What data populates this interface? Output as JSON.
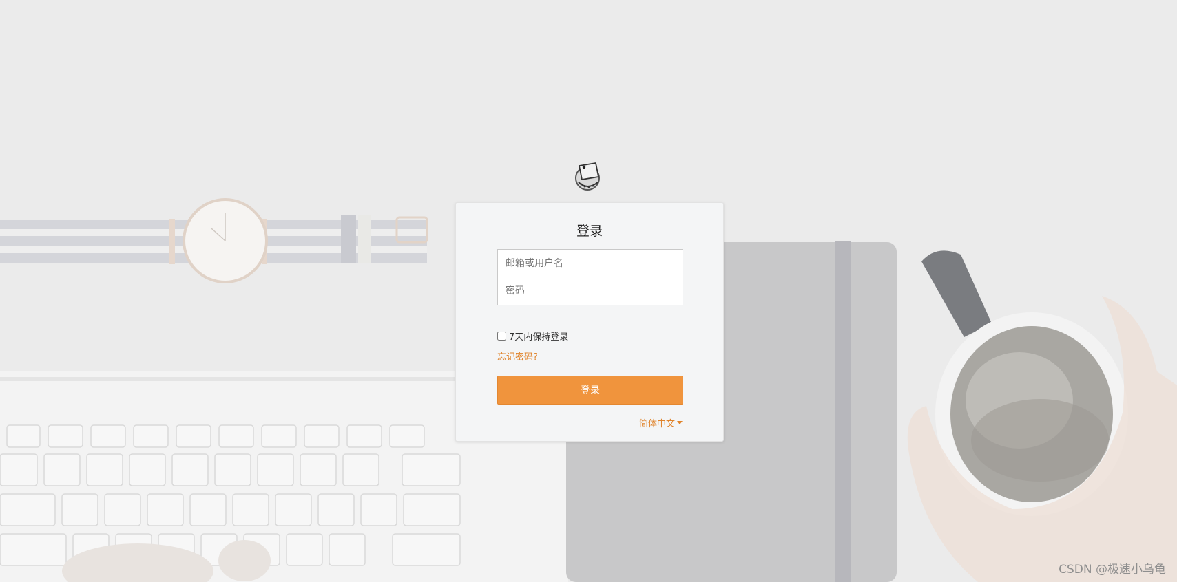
{
  "background": {
    "icon": "desk-photo-background"
  },
  "logo": {
    "icon": "flag-emblem-logo"
  },
  "login_card": {
    "title": "登录",
    "username_placeholder": "邮箱或用户名",
    "password_placeholder": "密码",
    "remember_label": "7天内保持登录",
    "forgot_link": "忘记密码?",
    "submit_label": "登录",
    "language": "简体中文"
  },
  "watermark": "CSDN @极速小乌龟",
  "colors": {
    "accent": "#f0943d",
    "link": "#e0832a",
    "background": "#ececec",
    "card": "#f4f5f6"
  }
}
